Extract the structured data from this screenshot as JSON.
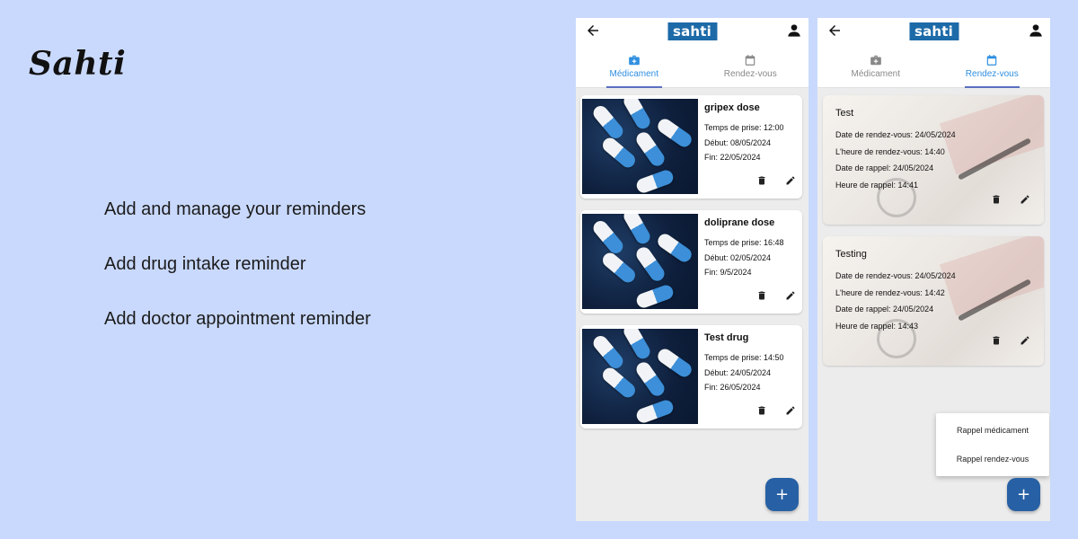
{
  "brand": "Sahti",
  "features": [
    "Add and manage your reminders",
    "Add drug intake reminder",
    "Add doctor appointment reminder"
  ],
  "app": {
    "logo": "sahti",
    "tabs": [
      "Médicament",
      "Rendez-vous"
    ],
    "fab_label": "+"
  },
  "screen1": {
    "active_tab": "Médicament",
    "medications": [
      {
        "name": "gripex dose",
        "time": "Temps de prise: 12:00",
        "start": "Début: 08/05/2024",
        "end": "Fin: 22/05/2024"
      },
      {
        "name": "doliprane dose",
        "time": "Temps de prise: 16:48",
        "start": "Début: 02/05/2024",
        "end": "Fin: 9/5/2024"
      },
      {
        "name": "Test drug",
        "time": "Temps de prise: 14:50",
        "start": "Début: 24/05/2024",
        "end": "Fin: 26/05/2024"
      }
    ]
  },
  "screen2": {
    "active_tab": "Rendez-vous",
    "appointments": [
      {
        "name": "Test",
        "date": "Date de rendez-vous: 24/05/2024",
        "hour": "L'heure de rendez-vous: 14:40",
        "reminder_date": "Date de rappel: 24/05/2024",
        "reminder_hour": "Heure de rappel: 14:41"
      },
      {
        "name": "Testing",
        "date": "Date de rendez-vous: 24/05/2024",
        "hour": "L'heure de rendez-vous: 14:42",
        "reminder_date": "Date de rappel: 24/05/2024",
        "reminder_hour": "Heure de rappel: 14:43"
      }
    ],
    "menu": [
      "Rappel médicament",
      "Rappel rendez-vous"
    ]
  },
  "colors": {
    "background": "#c9d9fd",
    "accent": "#2f8fe0",
    "fab": "#2760a4",
    "logo": "#1c6aa8"
  }
}
